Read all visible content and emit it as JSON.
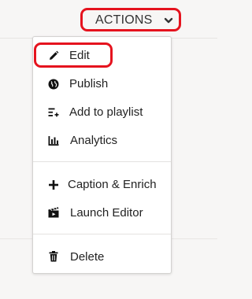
{
  "toolbar": {
    "actions_label": "ACTIONS",
    "chevron_icon": "chevron-down-icon"
  },
  "menu": {
    "items": [
      {
        "label": "Edit",
        "icon": "pencil-icon"
      },
      {
        "label": "Publish",
        "icon": "globe-icon"
      },
      {
        "label": "Add to playlist",
        "icon": "playlist-add-icon"
      },
      {
        "label": "Analytics",
        "icon": "bar-chart-icon"
      },
      {
        "label": "Caption & Enrich",
        "icon": "plus-icon"
      },
      {
        "label": "Launch Editor",
        "icon": "clapperboard-icon"
      },
      {
        "label": "Delete",
        "icon": "trash-icon"
      }
    ]
  },
  "colors": {
    "highlight": "#e5131e",
    "text": "#222222",
    "background": "#f7f6f5",
    "menu_background": "#ffffff"
  }
}
